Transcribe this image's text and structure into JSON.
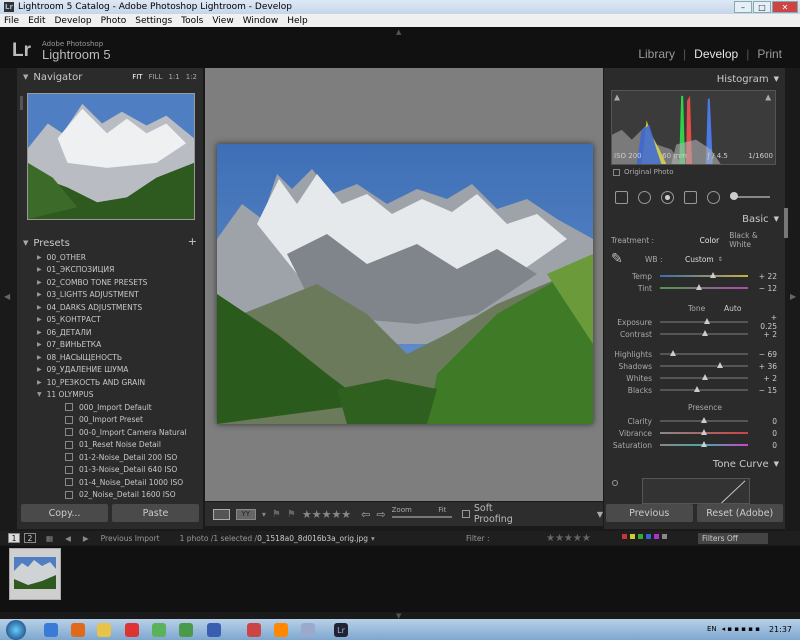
{
  "window": {
    "title": "Lightroom 5 Catalog - Adobe Photoshop Lightroom - Develop",
    "app_icon": "Lr"
  },
  "menu": [
    "File",
    "Edit",
    "Develop",
    "Photo",
    "Settings",
    "Tools",
    "View",
    "Window",
    "Help"
  ],
  "header": {
    "logo": "Lr",
    "product_small": "Adobe Photoshop",
    "product_large": "Lightroom 5",
    "modules": [
      "Library",
      "Develop",
      "Print"
    ],
    "active_module": "Develop",
    "separator": "|"
  },
  "navigator": {
    "title": "Navigator",
    "options": [
      "FIT",
      "FILL",
      "1:1",
      "1:2"
    ],
    "active_option": "FIT"
  },
  "presets": {
    "title": "Presets",
    "add": "+",
    "folders": [
      "00_OTHER",
      "01_ЭКСПОЗИЦИЯ",
      "02_COMBO TONE PRESETS",
      "03_LIGHTS ADJUSTMENT",
      "04_DARKS ADJUSTMENTS",
      "05_КОНТРАСТ",
      "06_ДЕТАЛИ",
      "07_ВИНЬЕТКА",
      "08_НАСЫЩЕНОСТЬ",
      "09_УДАЛЕНИЕ ШУМА",
      "10_РЕЗКОСТЬ AND GRAIN"
    ],
    "open_folder": "11 OLYMPUS",
    "items": [
      "000_Import Default",
      "00_Import Preset",
      "00-0_Import Camera Natural",
      "01_Reset Noise Detail",
      "01-2-Noise_Detail 200 ISO",
      "01-3-Noise_Detail 640 ISO",
      "01-4_Noise_Detail 1000 ISO",
      "02_Noise_Detail 1600 ISO"
    ]
  },
  "left_buttons": {
    "copy": "Copy...",
    "paste": "Paste"
  },
  "toolbar": {
    "stars": "★★★★★",
    "zoom_label": "Zoom",
    "fit_label": "Fit",
    "soft_proofing": "Soft Proofing",
    "view_glyph": "YY"
  },
  "histogram": {
    "title": "Histogram",
    "iso": "ISO 200",
    "focal": "60 mm",
    "aperture": "ƒ / 4.5",
    "shutter": "1/1600",
    "original_photo": "Original Photo"
  },
  "basic": {
    "title": "Basic",
    "treatment_label": "Treatment :",
    "treatment_options": [
      "Color",
      "Black & White"
    ],
    "treatment_active": "Color",
    "wb_label": "WB :",
    "wb_value": "Custom",
    "tone_label": "Tone",
    "auto_label": "Auto",
    "presence_label": "Presence",
    "sliders": [
      {
        "label": "Temp",
        "value": "+ 22",
        "pos": 0.6,
        "track": "temp"
      },
      {
        "label": "Tint",
        "value": "− 12",
        "pos": 0.44,
        "track": "tint"
      },
      {
        "label": "Exposure",
        "value": "+ 0.25",
        "pos": 0.53,
        "track": "gray"
      },
      {
        "label": "Contrast",
        "value": "+ 2",
        "pos": 0.51,
        "track": "gray"
      },
      {
        "label": "Highlights",
        "value": "− 69",
        "pos": 0.15,
        "track": "gray"
      },
      {
        "label": "Shadows",
        "value": "+ 36",
        "pos": 0.68,
        "track": "gray"
      },
      {
        "label": "Whites",
        "value": "+ 2",
        "pos": 0.51,
        "track": "gray"
      },
      {
        "label": "Blacks",
        "value": "− 15",
        "pos": 0.42,
        "track": "gray"
      },
      {
        "label": "Clarity",
        "value": "0",
        "pos": 0.5,
        "track": "gray"
      },
      {
        "label": "Vibrance",
        "value": "0",
        "pos": 0.5,
        "track": "vib"
      },
      {
        "label": "Saturation",
        "value": "0",
        "pos": 0.5,
        "track": "sat"
      }
    ]
  },
  "tone_curve": {
    "title": "Tone Curve"
  },
  "right_buttons": {
    "previous": "Previous",
    "reset": "Reset (Adobe)"
  },
  "filmstrip": {
    "pages": [
      "1",
      "2"
    ],
    "source": "Previous Import",
    "info": "1 photo /1 selected /",
    "filename": "0_1518a0_8d016b3a_orig.jpg",
    "filter_label": "Filter :",
    "filter_value": "Filters Off"
  },
  "taskbar": {
    "lang": "EN",
    "clock": "21:37"
  }
}
